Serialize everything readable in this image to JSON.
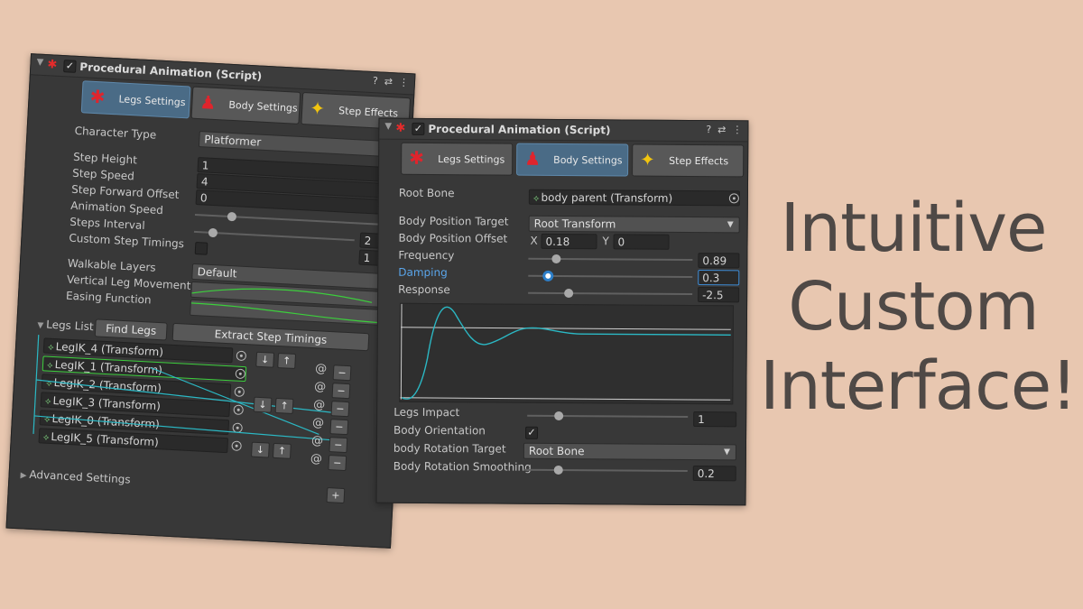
{
  "window_left": {
    "title": "Procedural Animation (Script)",
    "tabs": [
      "Legs Settings",
      "Body Settings",
      "Step Effects"
    ],
    "character_type_label": "Character Type",
    "character_type_value": "Platformer",
    "step_height_label": "Step Height",
    "step_height_value": "1",
    "step_speed_label": "Step Speed",
    "step_speed_value": "4",
    "step_forward_offset_label": "Step Forward Offset",
    "step_forward_offset_value": "0",
    "animation_speed_label": "Animation Speed",
    "steps_interval_label": "Steps Interval",
    "steps_interval_value": "2",
    "custom_step_timings_label": "Custom Step Timings",
    "custom_step_timings_value": "1",
    "walkable_layers_label": "Walkable Layers",
    "walkable_layers_value": "Default",
    "vertical_leg_movement_label": "Vertical Leg Movement",
    "easing_function_label": "Easing Function",
    "legs_list_label": "Legs List",
    "find_legs_button": "Find Legs",
    "extract_timings_button": "Extract Step Timings",
    "legs": [
      "LegIK_4 (Transform)",
      "LegIK_1 (Transform)",
      "LegIK_2 (Transform)",
      "LegIK_3 (Transform)",
      "LegIK_0 (Transform)",
      "LegIK_5 (Transform)"
    ],
    "advanced_settings_label": "Advanced Settings",
    "add_button": "+",
    "remove_button": "−",
    "down_arrow": "↓",
    "up_arrow": "↑"
  },
  "window_right": {
    "title": "Procedural Animation (Script)",
    "tabs": [
      "Legs Settings",
      "Body Settings",
      "Step Effects"
    ],
    "root_bone_label": "Root Bone",
    "root_bone_value": "body parent (Transform)",
    "body_position_target_label": "Body Position Target",
    "body_position_target_value": "Root Transform",
    "body_position_offset_label": "Body Position Offset",
    "offset_x_label": "X",
    "offset_x_value": "0.18",
    "offset_y_label": "Y",
    "offset_y_value": "0",
    "frequency_label": "Frequency",
    "frequency_value": "0.89",
    "damping_label": "Damping",
    "damping_value": "0.3",
    "response_label": "Response",
    "response_value": "-2.5",
    "legs_impact_label": "Legs Impact",
    "legs_impact_value": "1",
    "body_orientation_label": "Body Orientation",
    "body_rotation_target_label": "body Rotation Target",
    "body_rotation_target_value": "Root Bone",
    "body_rotation_smoothing_label": "Body Rotation Smoothing",
    "body_rotation_smoothing_value": "0.2"
  },
  "headline": [
    "Intuitive",
    "Custom",
    "Interface!"
  ],
  "icons": {
    "header": [
      "help-icon",
      "presets-icon",
      "kebab-menu-icon"
    ],
    "tab_icons": [
      "spider-icon",
      "body-figure-icon",
      "sparkle-icon"
    ]
  },
  "colors": {
    "background": "#e8c7b0",
    "panel": "#383838",
    "active_tab": "#4a6b86",
    "curve_green": "#3ccf3c",
    "response_cyan": "#2bb8c4",
    "focus_blue": "#3d8bd5",
    "headline": "#4f4946"
  }
}
